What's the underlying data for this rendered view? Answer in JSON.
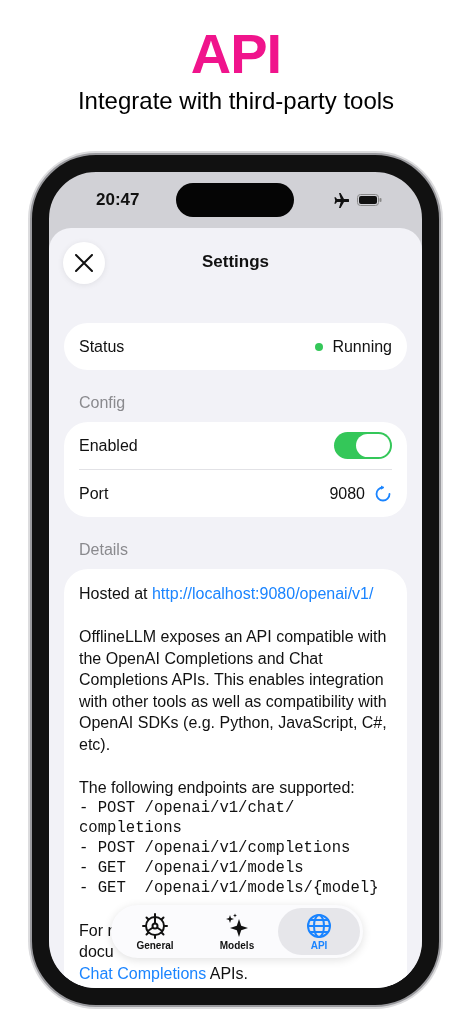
{
  "promo": {
    "title": "API",
    "subtitle": "Integrate with third-party tools"
  },
  "status_bar": {
    "time": "20:47"
  },
  "header": {
    "title": "Settings"
  },
  "status": {
    "label": "Status",
    "value": "Running",
    "color": "#34c759"
  },
  "config": {
    "title": "Config",
    "rows": [
      {
        "kind": "toggle",
        "label": "Enabled",
        "on": true
      },
      {
        "kind": "value",
        "label": "Port",
        "value": "9080"
      }
    ]
  },
  "details": {
    "title": "Details",
    "hosted_label": "Hosted at",
    "hosted_url": "http://localhost:9080/openai/v1/",
    "description": "OfflineLLM exposes an API compatible with the OpenAI Completions and Chat Completions APIs. This enables integration with other tools as well as compatibility with OpenAI SDKs (e.g. Python, JavaScript, C#, etc).",
    "endpoints_intro": "The following endpoints are supported:",
    "endpoints": [
      "- POST /openai/v1/chat/completions",
      "- POST /openai/v1/completions",
      "- GET  /openai/v1/models",
      "- GET  /openai/v1/models/{model}"
    ],
    "footer_fragments": [
      "For r",
      "docu"
    ],
    "footer_link": "Chat Completions",
    "footer_end": "APIs."
  },
  "tab_bar": {
    "tabs": [
      {
        "kind": "gear",
        "label": "General",
        "selected": false
      },
      {
        "kind": "sparkles",
        "label": "Models",
        "selected": false
      },
      {
        "kind": "globe",
        "label": "API",
        "selected": true
      }
    ]
  }
}
